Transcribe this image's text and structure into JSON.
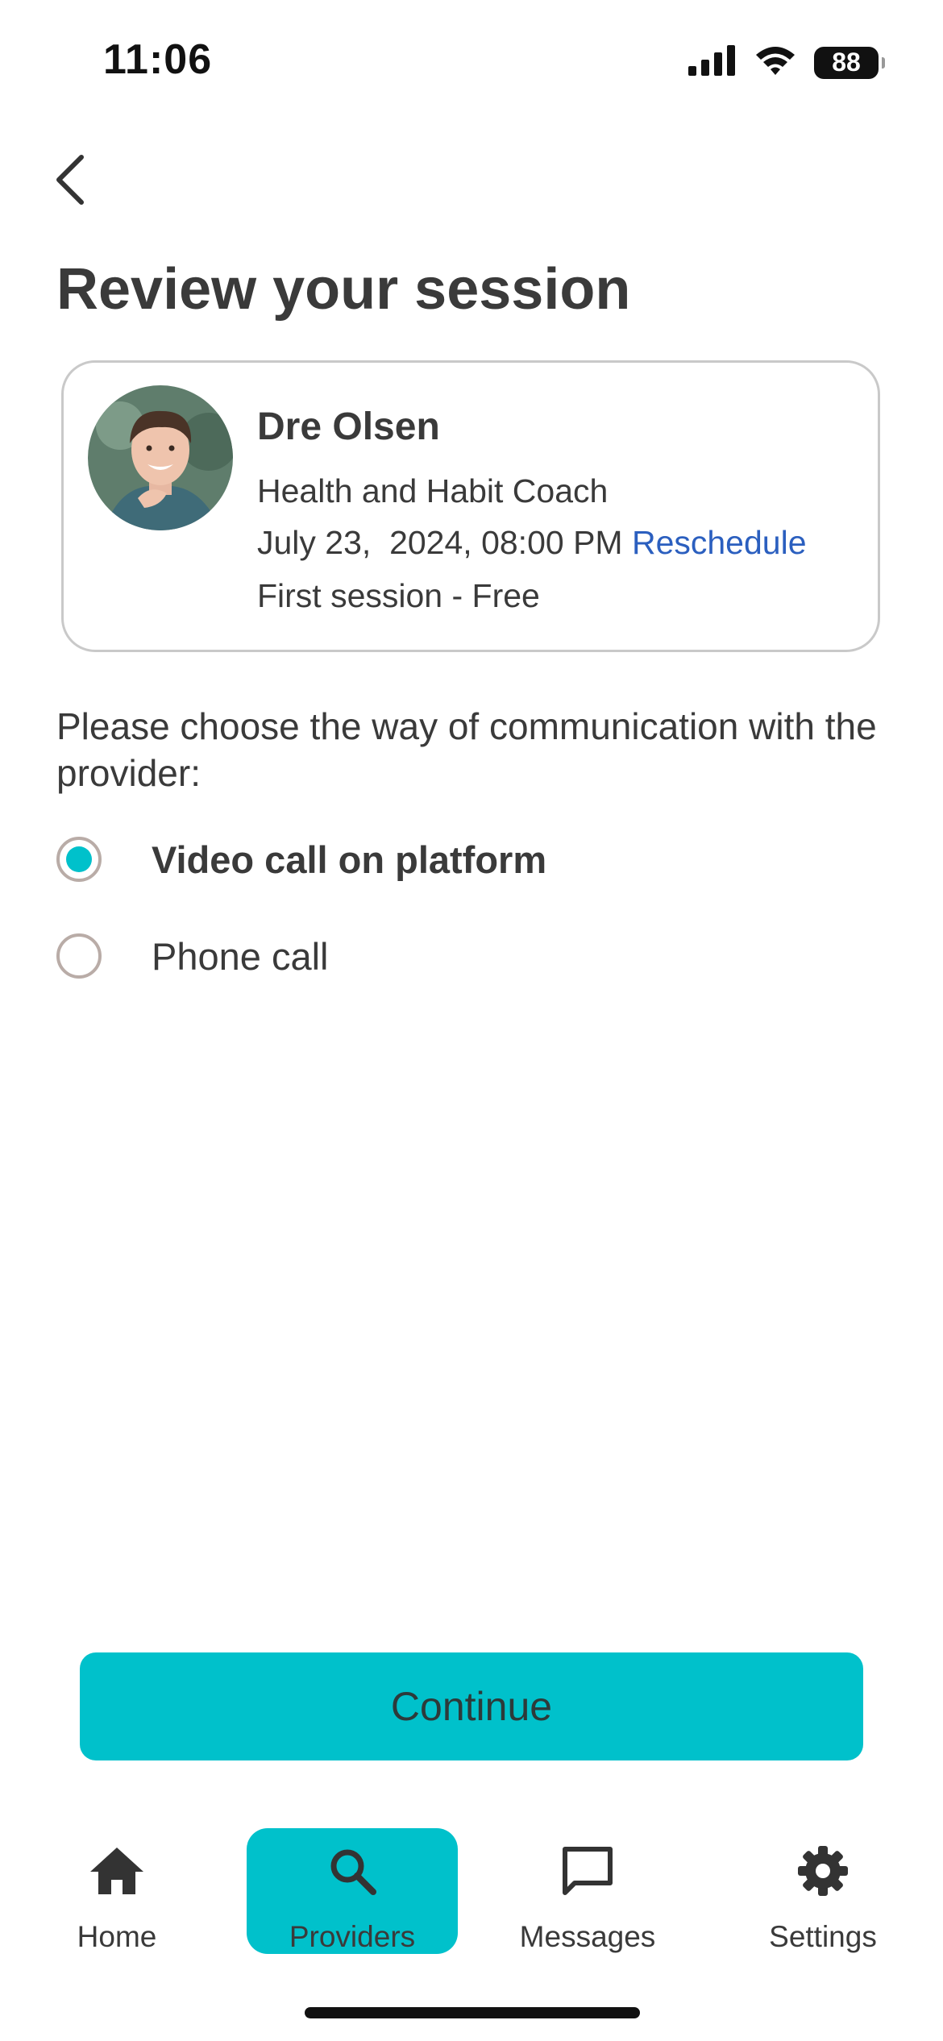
{
  "status_bar": {
    "time": "11:06",
    "battery": "88",
    "icons": [
      "signal-icon",
      "wifi-icon",
      "battery-icon"
    ]
  },
  "header": {
    "back_icon": "chevron-left-icon",
    "title": "Review your session"
  },
  "provider": {
    "name": "Dre Olsen",
    "role": "Health and Habit Coach",
    "datetime": "July 23,  2024, 08:00 PM",
    "reschedule_label": "Reschedule",
    "price": "First session - Free"
  },
  "communication": {
    "prompt": "Please choose the way of communication with the provider:",
    "options": [
      {
        "label": "Video call on platform",
        "selected": true
      },
      {
        "label": "Phone call",
        "selected": false
      }
    ]
  },
  "actions": {
    "continue_label": "Continue"
  },
  "bottom_nav": {
    "items": [
      {
        "label": "Home",
        "icon": "home-icon",
        "active": false
      },
      {
        "label": "Providers",
        "icon": "search-icon",
        "active": true
      },
      {
        "label": "Messages",
        "icon": "message-icon",
        "active": false
      },
      {
        "label": "Settings",
        "icon": "gear-icon",
        "active": false
      }
    ]
  },
  "colors": {
    "accent": "#00c1cb",
    "link": "#2b5fbf",
    "text": "#3a3a3a",
    "card_border": "#c9c9c9",
    "radio_border": "#b9aca7"
  }
}
